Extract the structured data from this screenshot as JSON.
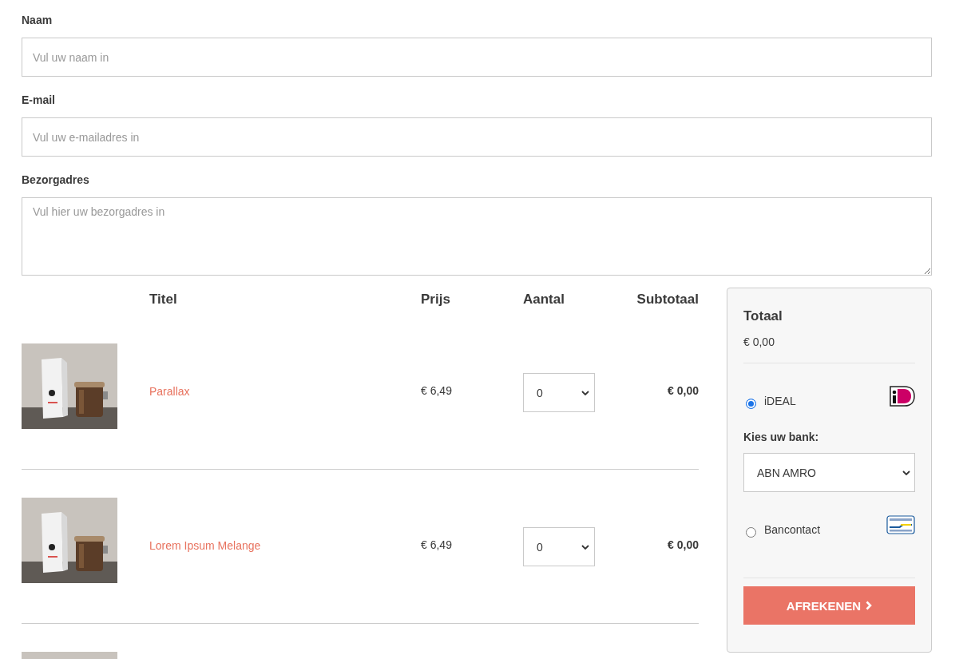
{
  "form": {
    "fields": [
      {
        "label": "Naam",
        "placeholder": "Vul uw naam in",
        "kind": "input"
      },
      {
        "label": "E-mail",
        "placeholder": "Vul uw e-mailadres in",
        "kind": "input"
      },
      {
        "label": "Bezorgadres",
        "placeholder": "Vul hier uw bezorgadres in",
        "kind": "textarea"
      }
    ]
  },
  "cart": {
    "columns": [
      "Titel",
      "Prijs",
      "Aantal",
      "Subtotaal"
    ],
    "rows": [
      {
        "image": {
          "kind": "picture"
        },
        "title": "Parallax",
        "price": "€ 6,49",
        "quantity": "0",
        "subtotal": "€ 0,00"
      },
      {
        "image": {
          "kind": "picture"
        },
        "title": "Lorem Ipsum Melange",
        "price": "€ 6,49",
        "quantity": "0",
        "subtotal": "€ 0,00"
      },
      {
        "image": {
          "kind": "picture"
        }
      }
    ]
  },
  "summary": {
    "title": "Totaal",
    "total": "€ 0,00",
    "payment_methods": [
      {
        "label": "iDEAL",
        "selected": true,
        "kind": "ideal",
        "bank_label": "Kies uw bank:",
        "bank": "ABN AMRO"
      },
      {
        "label": "Bancontact",
        "selected": false,
        "kind": "bancontact"
      }
    ],
    "checkout_button": "AFREKENEN"
  }
}
